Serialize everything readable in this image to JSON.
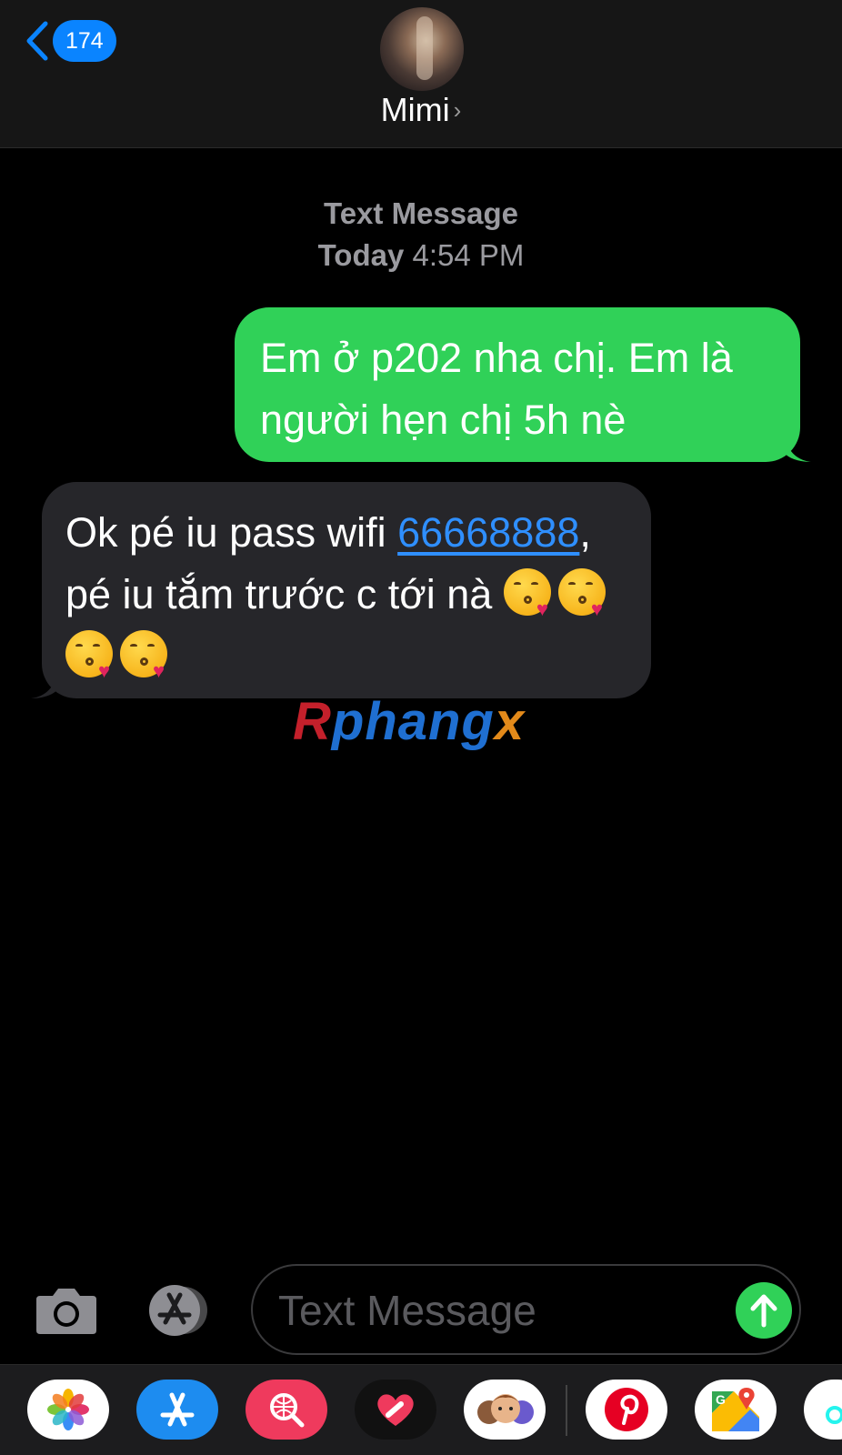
{
  "header": {
    "back_count": "174",
    "contact_name": "Mimi",
    "contact_chevron": "›"
  },
  "meta": {
    "service": "Text Message",
    "day": "Today",
    "time": "4:54 PM"
  },
  "messages": [
    {
      "direction": "outgoing",
      "text": "Em ở p202 nha chị. Em là người hẹn chị 5h nè"
    },
    {
      "direction": "incoming",
      "text_before_link": "Ok pé iu pass wifi ",
      "link": "66668888",
      "text_after_link": ", pé iu tắm trước c tới nà",
      "emoji": [
        "face-blowing-kiss",
        "face-blowing-kiss",
        "face-blowing-kiss",
        "face-blowing-kiss"
      ]
    }
  ],
  "watermark": {
    "part1": "R",
    "part2": "phang",
    "part3": "x"
  },
  "composer": {
    "placeholder": "Text Message"
  },
  "app_drawer": [
    "photos",
    "app-store",
    "web-images-search",
    "digital-touch",
    "memoji-stickers",
    "pinterest",
    "google-maps",
    "tiktok"
  ],
  "colors": {
    "outgoing_bubble": "#30d158",
    "incoming_bubble": "#26262a",
    "accent": "#0a84ff",
    "link": "#2f8fff"
  }
}
